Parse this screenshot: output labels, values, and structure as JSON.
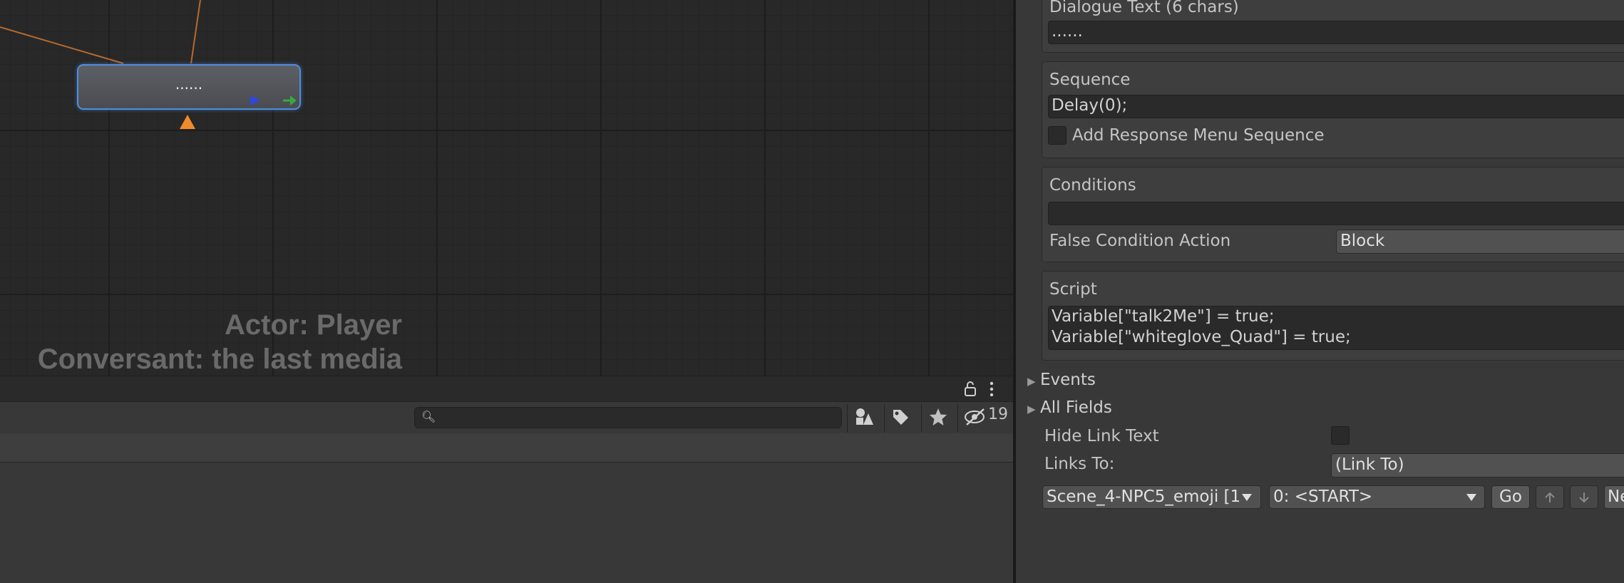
{
  "graph": {
    "node_text": "......",
    "actor_label": "Actor: Player",
    "conversant_label": "Conversant: the last media"
  },
  "toolbar": {
    "search_placeholder": "",
    "hidden_count": "19"
  },
  "inspector": {
    "dialogue_text_label": "Dialogue Text (6 chars)",
    "dialogue_text_value": "......",
    "sequence_label": "Sequence",
    "sequence_value": "Delay(0);",
    "add_response_menu_sequence_label": "Add Response Menu Sequence",
    "conditions_label": "Conditions",
    "conditions_value": "",
    "false_condition_action_label": "False Condition Action",
    "false_condition_action_value": "Block",
    "script_label": "Script",
    "script_line1": "Variable[\"talk2Me\"] = true;",
    "script_line2": "Variable[\"whiteglove_Quad\"] = true;",
    "events_label": "Events",
    "all_fields_label": "All Fields",
    "hide_link_text_label": "Hide Link Text",
    "links_to_label": "Links To:",
    "links_to_value": "(Link To)",
    "conversation_select": "Scene_4-NPC5_emoji [1",
    "entry_select": "0: <START>",
    "go_button": "Go",
    "new_button": "Ne"
  },
  "colors": {
    "accent_node_border": "#4f8ede",
    "link_line": "#b86a2c",
    "play_icon": "#2f46e0",
    "next_icon": "#3aa83a",
    "warning_triangle": "#f08a2c"
  }
}
